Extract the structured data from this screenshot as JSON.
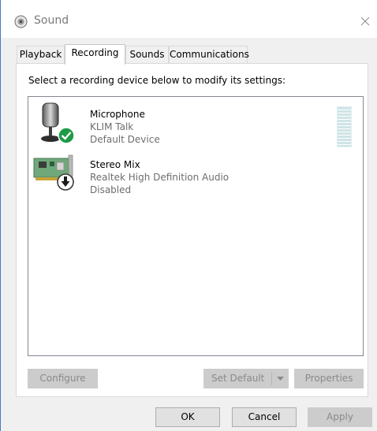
{
  "window": {
    "title": "Sound",
    "icon": "speaker-icon",
    "close_glyph": "✕"
  },
  "tabs": [
    {
      "label": "Playback",
      "active": false
    },
    {
      "label": "Recording",
      "active": true
    },
    {
      "label": "Sounds",
      "active": false
    },
    {
      "label": "Communications",
      "active": false
    }
  ],
  "panel": {
    "instruction": "Select a recording device below to modify its settings:"
  },
  "devices": [
    {
      "name": "Microphone",
      "description": "KLIM Talk",
      "status": "Default Device",
      "icon": "microphone-icon",
      "badge": "default-check-badge",
      "has_level_meter": true
    },
    {
      "name": "Stereo Mix",
      "description": "Realtek High Definition Audio",
      "status": "Disabled",
      "icon": "sound-card-icon",
      "badge": "disabled-down-arrow-badge"
    }
  ],
  "panel_buttons": {
    "configure": "Configure",
    "set_default": "Set Default",
    "properties": "Properties"
  },
  "dialog_buttons": {
    "ok": "OK",
    "cancel": "Cancel",
    "apply": "Apply"
  },
  "colors": {
    "window_border": "#4a7ac0",
    "default_badge": "#1e9b45",
    "level_meter": "#cfe4e6"
  }
}
